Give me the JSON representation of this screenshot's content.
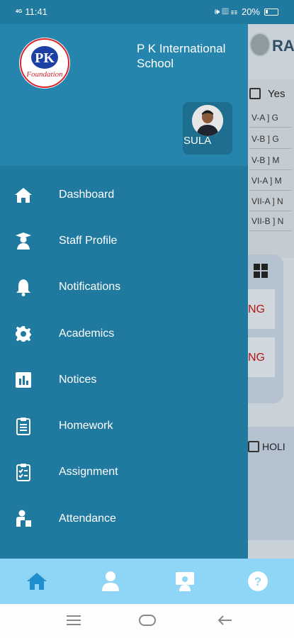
{
  "status_bar": {
    "time": "11:41",
    "signal": "4G",
    "battery": "20%"
  },
  "drawer": {
    "school_name": "P K International School",
    "logo_text": "PK",
    "logo_subtext": "Foundation",
    "staff_caption": "SULA"
  },
  "menu": [
    {
      "label": "Dashboard",
      "icon": "home-icon"
    },
    {
      "label": "Staff Profile",
      "icon": "graduate-icon"
    },
    {
      "label": "Notifications",
      "icon": "bell-icon"
    },
    {
      "label": "Academics",
      "icon": "gear-icon"
    },
    {
      "label": "Notices",
      "icon": "chart-icon"
    },
    {
      "label": "Homework",
      "icon": "clipboard-icon"
    },
    {
      "label": "Assignment",
      "icon": "checklist-icon"
    },
    {
      "label": "Attendance",
      "icon": "attendance-icon"
    }
  ],
  "background": {
    "header_text": "RA",
    "card_title": "Yes",
    "rows": [
      "V-A ] G",
      "V-B ] G",
      "V-B ] M",
      "VI-A ] M",
      "VII-A ] N",
      "VII-B ] N"
    ],
    "alerts": [
      "NG",
      "NG"
    ],
    "holiday_label": "HOLI"
  },
  "bottom_nav": [
    "home-icon",
    "person-icon",
    "teacher-icon",
    "help-icon"
  ],
  "colors": {
    "drawer": "#20799f",
    "header": "#2585ad",
    "bottom_nav": "#8fd6f6",
    "active": "#1f8fd0"
  }
}
